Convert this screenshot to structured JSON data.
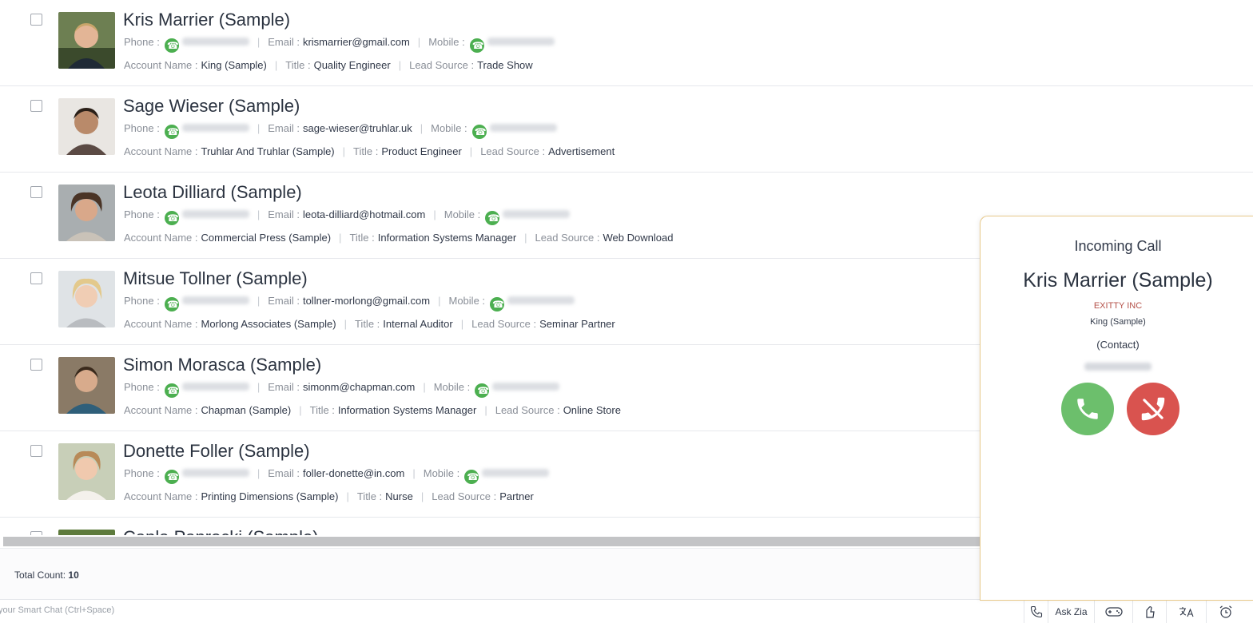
{
  "contacts": [
    {
      "name": "Kris Marrier (Sample)",
      "phone_label": "Phone",
      "email_label": "Email",
      "email": "krismarrier@gmail.com",
      "mobile_label": "Mobile",
      "account_label": "Account Name",
      "account": "King (Sample)",
      "title_label": "Title",
      "title": "Quality Engineer",
      "lead_label": "Lead Source",
      "lead_source": "Trade Show"
    },
    {
      "name": "Sage Wieser (Sample)",
      "phone_label": "Phone",
      "email_label": "Email",
      "email": "sage-wieser@truhlar.uk",
      "mobile_label": "Mobile",
      "account_label": "Account Name",
      "account": "Truhlar And Truhlar (Sample)",
      "title_label": "Title",
      "title": "Product Engineer",
      "lead_label": "Lead Source",
      "lead_source": "Advertisement"
    },
    {
      "name": "Leota Dilliard (Sample)",
      "phone_label": "Phone",
      "email_label": "Email",
      "email": "leota-dilliard@hotmail.com",
      "mobile_label": "Mobile",
      "account_label": "Account Name",
      "account": "Commercial Press (Sample)",
      "title_label": "Title",
      "title": "Information Systems Manager",
      "lead_label": "Lead Source",
      "lead_source": "Web Download"
    },
    {
      "name": "Mitsue Tollner (Sample)",
      "phone_label": "Phone",
      "email_label": "Email",
      "email": "tollner-morlong@gmail.com",
      "mobile_label": "Mobile",
      "account_label": "Account Name",
      "account": "Morlong Associates (Sample)",
      "title_label": "Title",
      "title": "Internal Auditor",
      "lead_label": "Lead Source",
      "lead_source": "Seminar Partner"
    },
    {
      "name": "Simon Morasca (Sample)",
      "phone_label": "Phone",
      "email_label": "Email",
      "email": "simonm@chapman.com",
      "mobile_label": "Mobile",
      "account_label": "Account Name",
      "account": "Chapman (Sample)",
      "title_label": "Title",
      "title": "Information Systems Manager",
      "lead_label": "Lead Source",
      "lead_source": "Online Store"
    },
    {
      "name": "Donette Foller (Sample)",
      "phone_label": "Phone",
      "email_label": "Email",
      "email": "foller-donette@in.com",
      "mobile_label": "Mobile",
      "account_label": "Account Name",
      "account": "Printing Dimensions (Sample)",
      "title_label": "Title",
      "title": "Nurse",
      "lead_label": "Lead Source",
      "lead_source": "Partner"
    },
    {
      "name": "Capla Paprocki (Sample)"
    }
  ],
  "footer": {
    "total_label": "Total Count:",
    "total_value": "10"
  },
  "bottom_bar": {
    "smart_chat_placeholder": "your Smart Chat (Ctrl+Space)",
    "ask_zia": "Ask Zia",
    "icons": [
      "phone-icon",
      "gamepad-icon",
      "feedback-icon",
      "translate-icon",
      "alarm-clock-icon"
    ]
  },
  "incoming_call": {
    "title": "Incoming Call",
    "name": "Kris Marrier (Sample)",
    "company": "EXITTY INC",
    "account": "King (Sample)",
    "type": "(Contact)",
    "accept_color": "#6cbf6c",
    "reject_color": "#d9534f"
  },
  "colors": {
    "call_green": "#4caf50",
    "panel_border": "#e8c98a"
  }
}
